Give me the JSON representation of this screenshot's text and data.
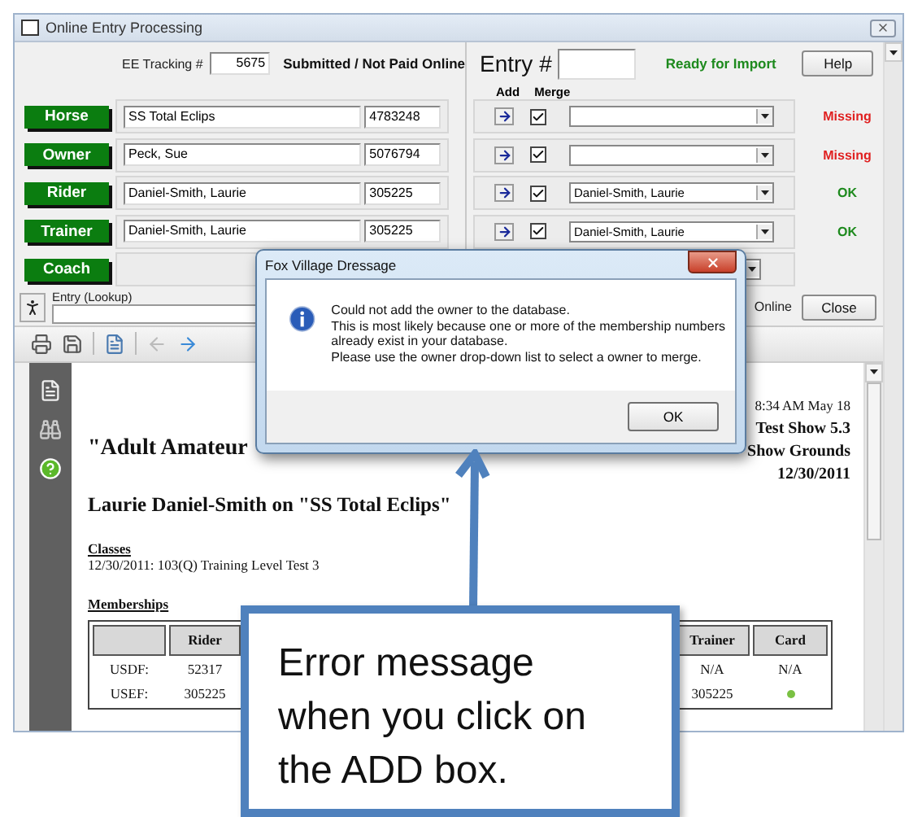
{
  "window": {
    "title": "Online Entry Processing"
  },
  "tracking": {
    "label": "EE Tracking #",
    "value": "5675",
    "status": "Submitted / Not Paid Online"
  },
  "entry": {
    "label": "Entry #",
    "status": "Ready for Import",
    "help_button": "Help"
  },
  "columns": [
    "Add",
    "Merge"
  ],
  "people": [
    {
      "kind": "full",
      "role": "Horse",
      "name": "SS Total Eclips",
      "number": "4783248",
      "merge": true,
      "ok": false,
      "status": "Missing"
    },
    {
      "kind": "full",
      "role": "Owner",
      "name": "Peck, Sue",
      "number": "5076794",
      "merge": true,
      "ok": false,
      "status": "Missing"
    },
    {
      "kind": "full",
      "role": "Rider",
      "name": "Daniel-Smith, Laurie",
      "number": "305225",
      "merge": true,
      "match": "Daniel-Smith, Laurie",
      "ok": true,
      "status": "OK"
    },
    {
      "kind": "full",
      "role": "Trainer",
      "name": "Daniel-Smith, Laurie",
      "number": "305225",
      "merge": true,
      "match": "Daniel-Smith, Laurie",
      "ok": true,
      "status": "OK"
    },
    {
      "kind": "covered",
      "role": "Coach"
    }
  ],
  "lookup": {
    "label": "Entry (Lookup)",
    "online": "Online",
    "close_button": "Close"
  },
  "report": {
    "time": "8:34 AM May 18",
    "show": "Test Show 5.3",
    "venue": "Show Grounds",
    "date": "12/30/2011",
    "heading": "\"Adult Amateur",
    "subheading": "Laurie Daniel-Smith on \"SS Total Eclips\"",
    "classes_label": "Classes",
    "classes": [
      "12/30/2011: 103(Q) Training Level Test 3"
    ],
    "memberships_label": "Memberships",
    "table": {
      "columns": [
        "Rider",
        "Trainer",
        "Card"
      ],
      "rows": [
        {
          "label": "USDF:",
          "rider": "52317",
          "trainer": "N/A",
          "card": {
            "kind": "text",
            "text": "N/A"
          }
        },
        {
          "label": "USEF:",
          "rider": "305225",
          "trainer": "305225",
          "card": {
            "kind": "dot",
            "color": "#7ac143"
          }
        }
      ]
    }
  },
  "dialog": {
    "title": "Fox Village Dressage",
    "message": [
      "Could not add the owner to the database.",
      "This is most likely because one or more of the membership numbers",
      "already exist in your database.",
      "Please use the owner drop-down list to select a owner to merge."
    ],
    "ok_button": "OK"
  },
  "callout": {
    "text": "Error message when you click on the ADD box."
  }
}
